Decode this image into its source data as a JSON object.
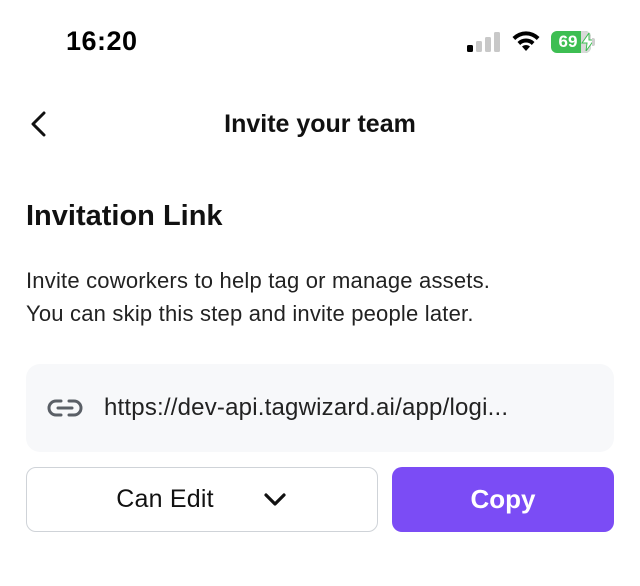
{
  "status_bar": {
    "time": "16:20",
    "battery_level": "69",
    "signal_icon": "cellular-signal-icon",
    "wifi_icon": "wifi-icon",
    "battery_icon": "battery-charging-icon"
  },
  "header": {
    "title": "Invite your team",
    "back_icon": "chevron-left-icon"
  },
  "section": {
    "title": "Invitation Link",
    "description_line1": "Invite coworkers to help tag or manage assets.",
    "description_line2": "You can skip this step and invite people later."
  },
  "invite_link": {
    "icon": "link-icon",
    "url": "https://dev-api.tagwizard.ai/app/logi..."
  },
  "permission": {
    "selected": "Can Edit",
    "icon": "chevron-down-icon"
  },
  "actions": {
    "copy_label": "Copy"
  },
  "colors": {
    "accent": "#7b4cf5",
    "battery": "#3dbe52",
    "link_box_bg": "#f7f8fa"
  }
}
